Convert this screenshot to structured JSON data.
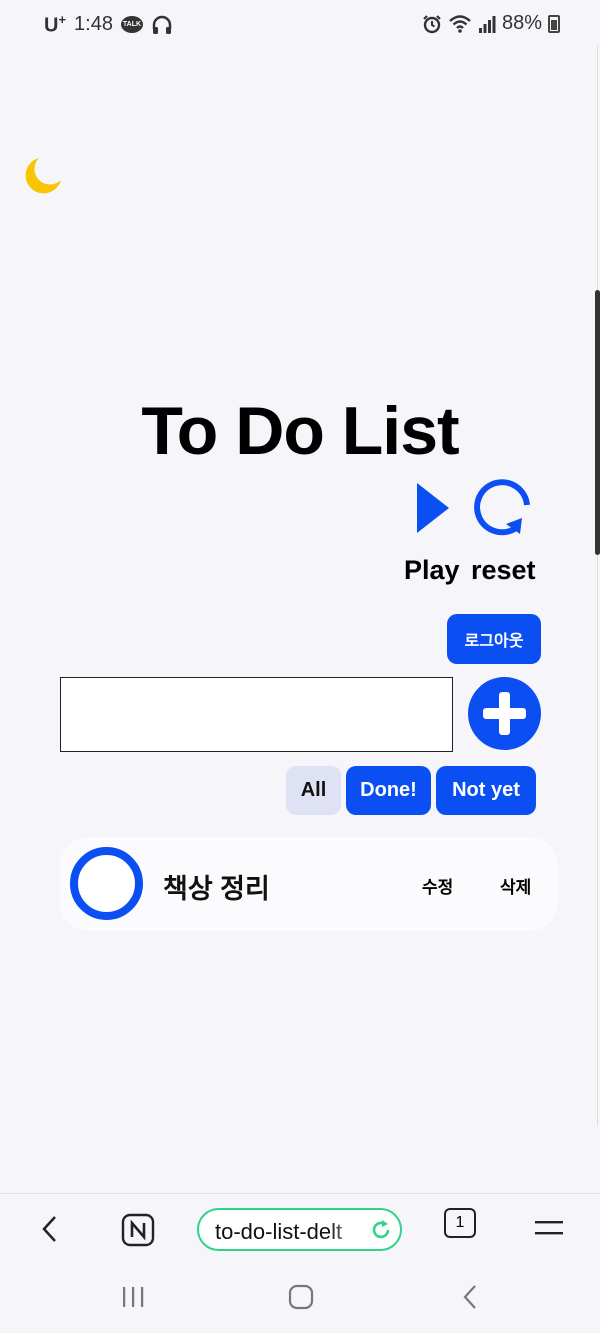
{
  "status_bar": {
    "carrier": "U",
    "carrier_sup": "+",
    "time": "1:48",
    "talk_badge": "TALK",
    "battery": "88%",
    "icons": [
      "talk-icon",
      "headphones-icon",
      "alarm-icon",
      "wifi-icon",
      "signal-icon",
      "battery-icon"
    ]
  },
  "app": {
    "title": "To Do List",
    "theme_icon": "moon-icon",
    "accent_color": "#0b4ff3",
    "moon_color": "#f9c400",
    "play_label": "Play",
    "reset_label": "reset",
    "logout_label": "로그아웃",
    "input_value": "",
    "add_icon": "plus-icon",
    "filters": {
      "all": "All",
      "done": "Done!",
      "not_yet": "Not yet"
    },
    "todos": [
      {
        "text": "책상 정리",
        "done": false,
        "edit_label": "수정",
        "delete_label": "삭제"
      }
    ]
  },
  "browser": {
    "url": "to-do-list-delt",
    "tab_count": "1",
    "icons": [
      "back-icon",
      "naver-icon",
      "refresh-icon",
      "tabs-icon",
      "menu-icon"
    ]
  },
  "nav": {
    "icons": [
      "recent-apps-icon",
      "home-icon",
      "nav-back-icon"
    ]
  }
}
